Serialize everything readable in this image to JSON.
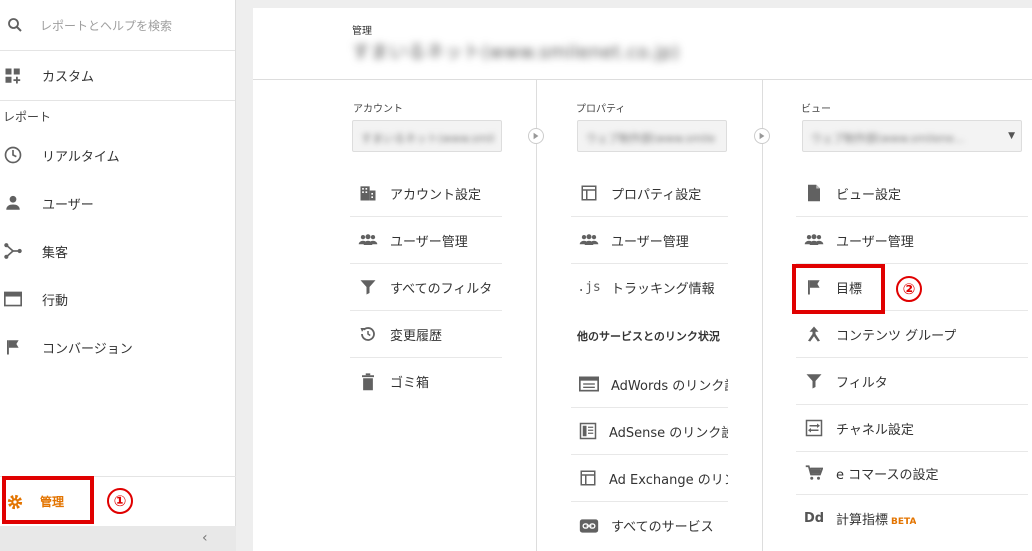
{
  "sidebar": {
    "search_placeholder": "レポートとヘルプを検索",
    "custom": "カスタム",
    "section_reports": "レポート",
    "items": [
      "リアルタイム",
      "ユーザー",
      "集客",
      "行動",
      "コンバージョン"
    ],
    "admin": "管理"
  },
  "annotations": {
    "one": "①",
    "two": "②"
  },
  "main": {
    "header_small": "管理",
    "property_title": "すまいるネット(www.smilenet.co.jp)",
    "account": {
      "header": "アカウント",
      "selector": "すまいるネット(www.smil",
      "items": [
        "アカウント設定",
        "ユーザー管理",
        "すべてのフィルタ",
        "変更履歴",
        "ゴミ箱"
      ]
    },
    "property": {
      "header": "プロパティ",
      "selector": "ウェブ制作部(www.smile",
      "items": [
        "プロパティ設定",
        "ユーザー管理",
        "トラッキング情報"
      ],
      "links_section": "他のサービスとのリンク状況",
      "links": [
        "AdWords のリンク設定",
        "AdSense のリンク設定",
        "Ad Exchange のリンク設定",
        "すべてのサービス"
      ]
    },
    "view": {
      "header": "ビュー",
      "selector": "ウェブ制作部(www.smilene...",
      "items": [
        "ビュー設定",
        "ユーザー管理",
        "目標",
        "コンテンツ グループ",
        "フィルタ",
        "チャネル設定",
        "e コマースの設定",
        "計算指標"
      ],
      "beta": "BETA"
    }
  },
  "colors": {
    "accent": "#e37400",
    "highlight": "#e00000",
    "icon": "#616161"
  }
}
